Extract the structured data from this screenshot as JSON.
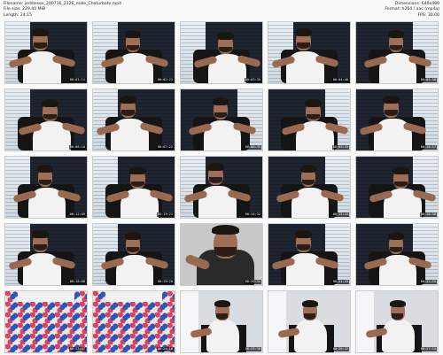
{
  "meta": {
    "filename": "Filename: jeddiesex_200716_2326_male_Chaturbate.mp4",
    "filesize": "File size: 229.40 MiB",
    "length": "Length: 24:15",
    "dimensions": "Dimensions: 640x480",
    "format": "Format: h264 / aac (mp4a)",
    "fps": "FPS: 30.00"
  },
  "thumbnails": [
    {
      "ts": "00:01:11",
      "scene": "window-left"
    },
    {
      "ts": "00:02:23",
      "scene": "window-left"
    },
    {
      "ts": "00:03:35",
      "scene": "window-left"
    },
    {
      "ts": "00:04:46",
      "scene": "window-left"
    },
    {
      "ts": "00:05:58",
      "scene": "window-right"
    },
    {
      "ts": "00:06:10",
      "scene": "window-left"
    },
    {
      "ts": "00:07:22",
      "scene": "window-left"
    },
    {
      "ts": "00:08:33",
      "scene": "window-right"
    },
    {
      "ts": "00:09:45",
      "scene": "window-right"
    },
    {
      "ts": "00:10:57",
      "scene": "window-right"
    },
    {
      "ts": "00:12:09",
      "scene": "window-left"
    },
    {
      "ts": "00:13:21",
      "scene": "window-left"
    },
    {
      "ts": "00:14:32",
      "scene": "window-left"
    },
    {
      "ts": "00:15:44",
      "scene": "window-right"
    },
    {
      "ts": "00:16:56",
      "scene": "window-right"
    },
    {
      "ts": "00:18:08",
      "scene": "window-left"
    },
    {
      "ts": "00:19:20",
      "scene": "window-left"
    },
    {
      "ts": "00:20:31",
      "scene": "closeup"
    },
    {
      "ts": "00:21:43",
      "scene": "window-right"
    },
    {
      "ts": "00:22:55",
      "scene": "window-right"
    },
    {
      "ts": "00:23:07",
      "scene": "shorts"
    },
    {
      "ts": "00:24:18",
      "scene": "shorts"
    },
    {
      "ts": "00:25:30",
      "scene": "room"
    },
    {
      "ts": "00:26:42",
      "scene": "room"
    },
    {
      "ts": "00:27:54",
      "scene": "room"
    }
  ]
}
